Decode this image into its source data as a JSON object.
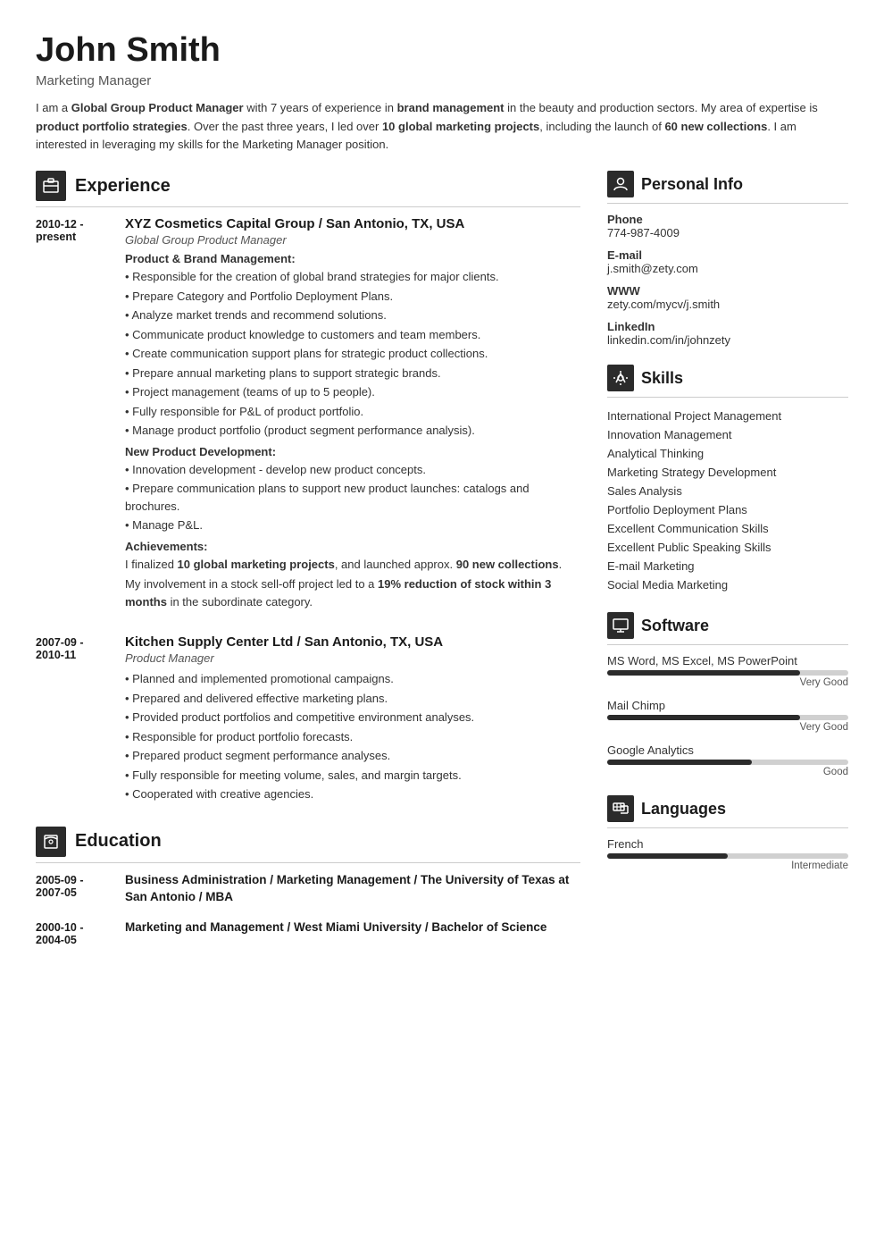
{
  "header": {
    "name": "John Smith",
    "title": "Marketing Manager",
    "summary": "I am a <strong>Global Group Product Manager</strong> with 7 years of experience in <strong>brand management</strong> in the beauty and production sectors. My area of expertise is <strong>product portfolio strategies</strong>. Over the past three years, I led over <strong>10 global marketing projects</strong>, including the launch of <strong>60 new collections</strong>. I am interested in leveraging my skills for the Marketing Manager position."
  },
  "experience": {
    "section_title": "Experience",
    "entries": [
      {
        "date": "2010-12 - present",
        "company": "XYZ Cosmetics Capital Group / San Antonio, TX, USA",
        "role": "Global Group Product Manager",
        "subsections": [
          {
            "header": "Product & Brand Management:",
            "bullets": [
              "Responsible for the creation of global brand strategies for major clients.",
              "Prepare Category and Portfolio Deployment Plans.",
              "Analyze market trends and recommend solutions.",
              "Communicate product knowledge to customers and team members.",
              "Create communication support plans for strategic product collections.",
              "Prepare annual marketing plans to support strategic brands.",
              "Project management (teams of up to 5 people).",
              "Fully responsible for P&L of product portfolio.",
              "Manage product portfolio (product segment performance analysis)."
            ]
          },
          {
            "header": "New Product Development:",
            "bullets": [
              "Innovation development - develop new product concepts.",
              "Prepare communication plans to support new product launches: catalogs and brochures.",
              "Manage P&L."
            ]
          },
          {
            "header": "Achievements:",
            "bullets": []
          }
        ],
        "achievements": [
          "I finalized <strong>10 global marketing projects</strong>, and launched approx. <strong>90 new collections</strong>.",
          "My involvement in a stock sell-off project led to a <strong>19% reduction of stock within 3 months</strong> in the subordinate category."
        ]
      },
      {
        "date": "2007-09 - 2010-11",
        "company": "Kitchen Supply Center Ltd / San Antonio, TX, USA",
        "role": "Product Manager",
        "subsections": [],
        "bullets": [
          "Planned and implemented promotional campaigns.",
          "Prepared and delivered effective marketing plans.",
          "Provided product portfolios and competitive environment analyses.",
          "Responsible for product portfolio forecasts.",
          "Prepared product segment performance analyses.",
          "Fully responsible for meeting volume, sales, and margin targets.",
          "Cooperated with creative agencies."
        ]
      }
    ]
  },
  "education": {
    "section_title": "Education",
    "entries": [
      {
        "date": "2005-09 - 2007-05",
        "degree": "Business Administration / Marketing Management / The University of Texas at San Antonio / MBA"
      },
      {
        "date": "2000-10 - 2004-05",
        "degree": "Marketing and Management / West Miami University / Bachelor of Science"
      }
    ]
  },
  "personal_info": {
    "section_title": "Personal Info",
    "fields": [
      {
        "label": "Phone",
        "value": "774-987-4009"
      },
      {
        "label": "E-mail",
        "value": "j.smith@zety.com"
      },
      {
        "label": "WWW",
        "value": "zety.com/mycv/j.smith"
      },
      {
        "label": "LinkedIn",
        "value": "linkedin.com/in/johnzety"
      }
    ]
  },
  "skills": {
    "section_title": "Skills",
    "items": [
      "International Project Management",
      "Innovation Management",
      "Analytical Thinking",
      "Marketing Strategy Development",
      "Sales Analysis",
      "Portfolio Deployment Plans",
      "Excellent Communication Skills",
      "Excellent Public Speaking Skills",
      "E-mail Marketing",
      "Social Media Marketing"
    ]
  },
  "software": {
    "section_title": "Software",
    "items": [
      {
        "name": "MS Word, MS Excel, MS PowerPoint",
        "level": "Very Good",
        "percent": 80
      },
      {
        "name": "Mail Chimp",
        "level": "Very Good",
        "percent": 80
      },
      {
        "name": "Google Analytics",
        "level": "Good",
        "percent": 60
      }
    ]
  },
  "languages": {
    "section_title": "Languages",
    "items": [
      {
        "name": "French",
        "level": "Intermediate",
        "percent": 50
      }
    ]
  },
  "icons": {
    "experience": "🗃",
    "education": "✉",
    "personal": "👤",
    "skills": "🔧",
    "software": "🖥",
    "languages": "🚩"
  }
}
